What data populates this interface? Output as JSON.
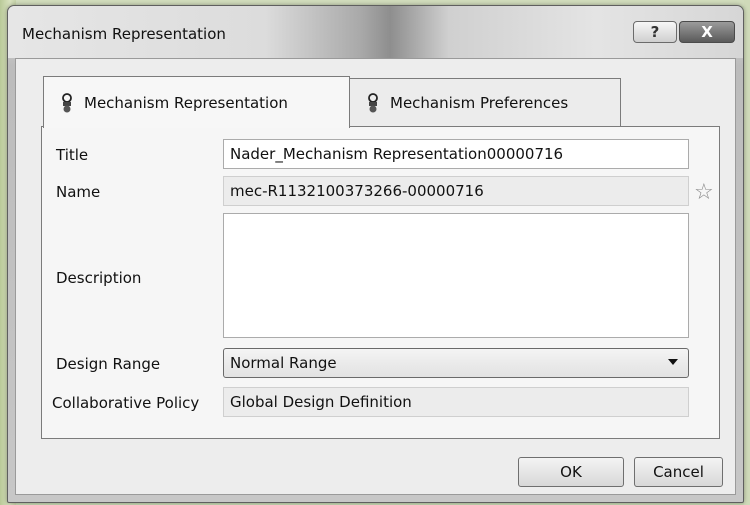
{
  "window": {
    "title": "Mechanism Representation",
    "help_label": "?",
    "close_label": "X"
  },
  "tabs": [
    {
      "label": "Mechanism Representation",
      "icon": "mechanism-icon",
      "selected": true
    },
    {
      "label": "Mechanism Preferences",
      "icon": "mechanism-icon",
      "selected": false
    }
  ],
  "form": {
    "title_label": "Title",
    "title_value": "Nader_Mechanism Representation00000716",
    "name_label": "Name",
    "name_value": "mec-R1132100373266-00000716",
    "name_icon": "star-icon",
    "description_label": "Description",
    "description_value": "",
    "design_range_label": "Design Range",
    "design_range_value": "Normal Range",
    "policy_label": "Collaborative Policy",
    "policy_value": "Global Design Definition"
  },
  "buttons": {
    "ok": "OK",
    "cancel": "Cancel"
  }
}
